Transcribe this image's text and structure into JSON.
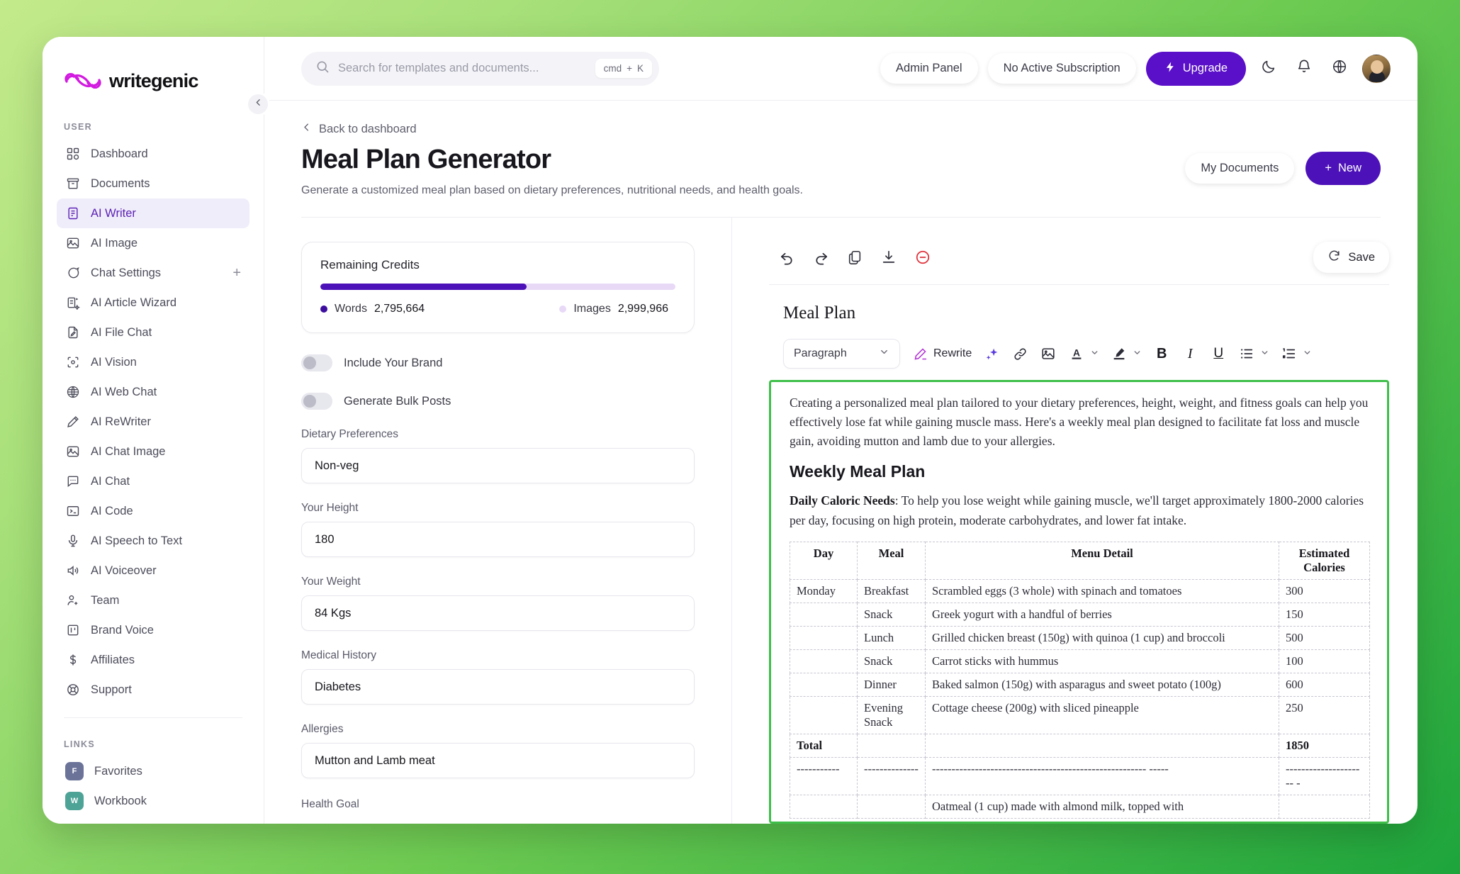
{
  "brand": {
    "name": "writegenic"
  },
  "sidebar": {
    "user_section_label": "USER",
    "links_section_label": "LINKS",
    "items": [
      {
        "label": "Dashboard",
        "icon": "grid-icon"
      },
      {
        "label": "Documents",
        "icon": "archive-icon"
      },
      {
        "label": "AI Writer",
        "icon": "document-text-icon"
      },
      {
        "label": "AI Image",
        "icon": "image-icon"
      },
      {
        "label": "Chat Settings",
        "icon": "chat-bubble-icon",
        "trailing": "+"
      },
      {
        "label": "AI Article Wizard",
        "icon": "article-wizard-icon"
      },
      {
        "label": "AI File Chat",
        "icon": "file-pencil-icon"
      },
      {
        "label": "AI Vision",
        "icon": "eye-scan-icon"
      },
      {
        "label": "AI Web Chat",
        "icon": "globe-www-icon"
      },
      {
        "label": "AI ReWriter",
        "icon": "pencil-icon"
      },
      {
        "label": "AI Chat Image",
        "icon": "image-icon"
      },
      {
        "label": "AI Chat",
        "icon": "chat-dots-icon"
      },
      {
        "label": "AI Code",
        "icon": "terminal-icon"
      },
      {
        "label": "AI Speech to Text",
        "icon": "microphone-icon"
      },
      {
        "label": "AI Voiceover",
        "icon": "speaker-icon"
      },
      {
        "label": "Team",
        "icon": "user-plus-icon"
      },
      {
        "label": "Brand Voice",
        "icon": "brand-board-icon"
      },
      {
        "label": "Affiliates",
        "icon": "dollar-icon"
      },
      {
        "label": "Support",
        "icon": "lifebuoy-icon"
      }
    ],
    "active_item": "AI Writer",
    "links": [
      {
        "label": "Favorites",
        "badge": "F",
        "color": "#6b7399"
      },
      {
        "label": "Workbook",
        "badge": "W",
        "color": "#4ea397"
      }
    ]
  },
  "topbar": {
    "search_placeholder": "Search for templates and documents...",
    "shortcut_cmd": "cmd",
    "shortcut_plus": "+",
    "shortcut_key": "K",
    "admin_panel_label": "Admin Panel",
    "subscription_label": "No Active Subscription",
    "upgrade_label": "Upgrade"
  },
  "page": {
    "back_label": "Back to dashboard",
    "title": "Meal Plan Generator",
    "subtitle": "Generate a customized meal plan based on dietary preferences, nutritional needs, and health goals.",
    "my_documents_label": "My Documents",
    "new_label": "New",
    "new_plus": "+"
  },
  "credits": {
    "title": "Remaining Credits",
    "progress_percent": 58,
    "words_label": "Words",
    "words_value": "2,795,664",
    "words_color": "#3c0d9e",
    "images_label": "Images",
    "images_value": "2,999,966",
    "images_color": "#e8d9f7"
  },
  "form": {
    "toggles": [
      {
        "label": "Include Your Brand",
        "on": false
      },
      {
        "label": "Generate Bulk Posts",
        "on": false
      }
    ],
    "fields": [
      {
        "label": "Dietary Preferences",
        "value": "Non-veg"
      },
      {
        "label": "Your Height",
        "value": "180"
      },
      {
        "label": "Your Weight",
        "value": "84 Kgs"
      },
      {
        "label": "Medical History",
        "value": "Diabetes"
      },
      {
        "label": "Allergies",
        "value": "Mutton and Lamb meat"
      }
    ],
    "last_label": "Health Goal"
  },
  "editor": {
    "save_label": "Save",
    "document_title": "Meal Plan",
    "paragraph_select": "Paragraph",
    "rewrite_label": "Rewrite",
    "toolbar_icons": [
      "undo-icon",
      "redo-icon",
      "copy-icon",
      "download-icon",
      "clear-icon"
    ],
    "format_icons": [
      "sparkle-icon",
      "link-icon",
      "image-icon",
      "text-color-icon",
      "highlight-icon",
      "bold-icon",
      "italic-icon",
      "underline-icon",
      "bullet-list-icon",
      "numbered-list-icon"
    ],
    "bold_label": "B",
    "italic_label": "I",
    "underline_label": "U"
  },
  "document": {
    "intro": "Creating a personalized meal plan tailored to your dietary preferences, height, weight, and fitness goals can help you effectively lose fat while gaining muscle mass. Here's a weekly meal plan designed to facilitate fat loss and muscle gain, avoiding mutton and lamb due to your allergies.",
    "heading": "Weekly Meal Plan",
    "caloric_label": "Daily Caloric Needs",
    "caloric_text": ": To help you lose weight while gaining muscle, we'll target approximately 1800-2000 calories per day, focusing on high protein, moderate carbohydrates, and lower fat intake."
  },
  "chart_data": {
    "type": "table",
    "title": "Weekly Meal Plan",
    "columns": [
      "Day",
      "Meal",
      "Menu Detail",
      "Estimated Calories"
    ],
    "rows": [
      [
        "Monday",
        "Breakfast",
        "Scrambled eggs (3 whole) with spinach and tomatoes",
        "300"
      ],
      [
        "",
        "Snack",
        "Greek yogurt with a handful of berries",
        "150"
      ],
      [
        "",
        "Lunch",
        "Grilled chicken breast (150g) with quinoa (1 cup) and broccoli",
        "500"
      ],
      [
        "",
        "Snack",
        "Carrot sticks with hummus",
        "100"
      ],
      [
        "",
        "Dinner",
        "Baked salmon (150g) with asparagus and sweet potato (100g)",
        "600"
      ],
      [
        "",
        "Evening Snack",
        "Cottage cheese (200g) with sliced pineapple",
        "250"
      ],
      [
        "Total",
        "",
        "",
        "1850"
      ],
      [
        "-----------",
        "--------------",
        "------------------------------------------------------- -----",
        "--------------------- -"
      ],
      [
        "",
        "",
        "Oatmeal (1 cup) made with almond milk, topped with",
        ""
      ]
    ],
    "total_row_index": 6,
    "total_label": "Total",
    "total_value": "1850"
  }
}
